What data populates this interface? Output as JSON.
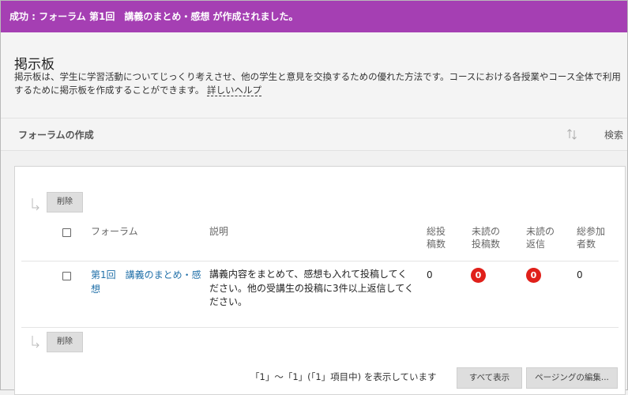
{
  "success_message": "成功 : フォーラム 第1回　講義のまとめ・感想 が作成されました。",
  "header": {
    "title": "掲示板",
    "description": "掲示板は、学生に学習活動についてじっくり考えさせ、他の学生と意見を交換するための優れた方法です。コースにおける各授業やコース全体で利用するために掲示板を作成することができます。",
    "help_link": "詳しいヘルプ"
  },
  "toolbar": {
    "create_forum": "フォーラムの作成",
    "search": "検索",
    "sort_icon": "sort-arrows-icon"
  },
  "actions": {
    "delete_label": "削除"
  },
  "table": {
    "columns": {
      "forum": "フォーラム",
      "description": "説明",
      "total_posts": "総投稿数",
      "unread_posts": "未読の投稿数",
      "unread_replies": "未読の返信",
      "participants": "総参加者数"
    },
    "rows": [
      {
        "forum": "第1回　講義のまとめ・感想",
        "description": "講義内容をまとめて、感想も入れて投稿してください。他の受講生の投稿に3件以上返信してください。",
        "total_posts": "0",
        "unread_posts": "0",
        "unread_replies": "0",
        "participants": "0"
      }
    ]
  },
  "paging": {
    "summary": "「1」～「1」(「1」項目中) を表示しています",
    "show_all": "すべて表示",
    "edit_paging": "ページングの編集..."
  },
  "colors": {
    "success_bar": "#a53fb3",
    "link": "#1f6fa8",
    "badge": "#e0201a"
  }
}
